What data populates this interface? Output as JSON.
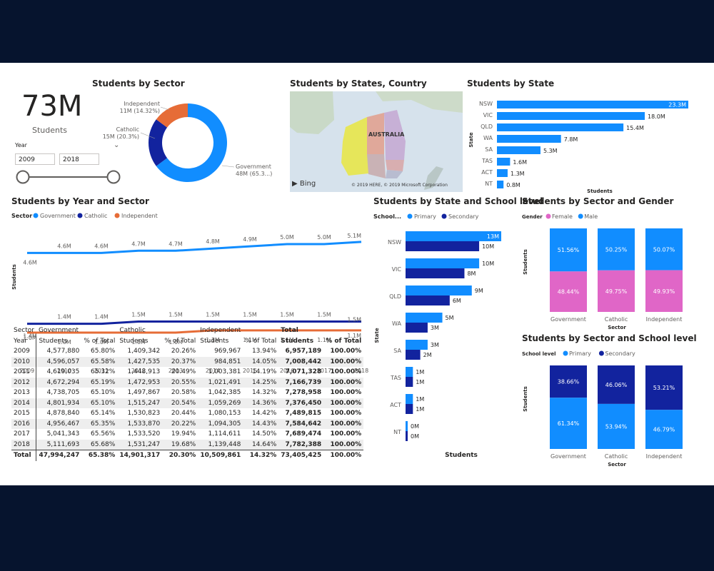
{
  "colors": {
    "government": "#118dff",
    "catholic": "#12239e",
    "independent": "#e66c37",
    "primary": "#118dff",
    "secondary": "#12239e",
    "female": "#e066c7",
    "male": "#118dff",
    "state_bar": "#118dff",
    "frame": "#06142e"
  },
  "card": {
    "value": "73M",
    "label": "Students"
  },
  "slicer": {
    "label": "Year",
    "from": "2009",
    "to": "2018",
    "chevron_icon": "chevron-down-icon"
  },
  "titles": {
    "sector": "Students by Sector",
    "map": "Students by States, Country",
    "state": "Students by State",
    "year_sector": "Students by Year and Sector",
    "state_level": "Students by State and School level",
    "sector_gender": "Students by Sector and Gender",
    "sector_level": "Students by Sector and School level"
  },
  "donut": {
    "slices": [
      {
        "name": "Government",
        "value": 48,
        "label_l1": "Government",
        "label_l2": "48M (65.3...)"
      },
      {
        "name": "Catholic",
        "value": 15,
        "label_l1": "Catholic",
        "label_l2": "15M (20.3%)"
      },
      {
        "name": "Independent",
        "value": 11,
        "label_l1": "Independent",
        "label_l2": "11M (14.32%)"
      }
    ]
  },
  "map": {
    "country_label": "AUSTRALIA",
    "bing": "Bing",
    "copyright": "© 2019 HERE, © 2019 Microsoft Corporation"
  },
  "state_chart": {
    "axis_y": "State",
    "axis_x": "Students",
    "categories": [
      "NSW",
      "VIC",
      "QLD",
      "WA",
      "SA",
      "TAS",
      "ACT",
      "NT"
    ],
    "values": [
      23.3,
      18.0,
      15.4,
      7.8,
      5.3,
      1.6,
      1.3,
      0.8
    ],
    "labels": [
      "23.3M",
      "18.0M",
      "15.4M",
      "7.8M",
      "5.3M",
      "1.6M",
      "1.3M",
      "0.8M"
    ]
  },
  "year_sector": {
    "legend_title": "Sector",
    "legend": [
      "Government",
      "Catholic",
      "Independent"
    ],
    "axis_y": "Students",
    "axis_x": "Year",
    "years": [
      "2009",
      "2010",
      "2011",
      "2012",
      "2013",
      "2014",
      "2015",
      "2016",
      "2017",
      "2018"
    ],
    "series": [
      {
        "name": "Government",
        "values": [
          4.6,
          4.6,
          4.6,
          4.7,
          4.7,
          4.8,
          4.9,
          5.0,
          5.0,
          5.1
        ],
        "labels": [
          "4.6M",
          "4.6M",
          "4.6M",
          "4.7M",
          "4.7M",
          "4.8M",
          "4.9M",
          "5.0M",
          "5.0M",
          "5.1M"
        ]
      },
      {
        "name": "Catholic",
        "values": [
          1.4,
          1.4,
          1.4,
          1.5,
          1.5,
          1.5,
          1.5,
          1.5,
          1.5,
          1.5
        ],
        "labels": [
          "1.4M",
          "1.4M",
          "1.4M",
          "1.5M",
          "1.5M",
          "1.5M",
          "1.5M",
          "1.5M",
          "1.5M",
          "1.5M"
        ]
      },
      {
        "name": "Independent",
        "values": [
          1.0,
          1.0,
          1.0,
          1.0,
          1.0,
          1.1,
          1.1,
          1.1,
          1.1,
          1.1
        ],
        "labels": [
          "1.0M",
          "1.0M",
          "1.0M",
          "1.0M",
          "1.0M",
          "1.1M",
          "1.1M",
          "1.1M",
          "1.1M",
          "1.1M"
        ]
      }
    ]
  },
  "matrix": {
    "header1": [
      "Sector",
      "Government",
      "",
      "Catholic",
      "",
      "Independent",
      "",
      "Total",
      ""
    ],
    "header2": [
      "Year",
      "Students",
      "% of Total",
      "Students",
      "% of Total",
      "Students",
      "% of Total",
      "Students",
      "% of Total"
    ],
    "rows": [
      [
        "2009",
        "4,577,880",
        "65.80%",
        "1,409,342",
        "20.26%",
        "969,967",
        "13.94%",
        "6,957,189",
        "100.00%"
      ],
      [
        "2010",
        "4,596,057",
        "65.58%",
        "1,427,535",
        "20.37%",
        "984,851",
        "14.05%",
        "7,008,442",
        "100.00%"
      ],
      [
        "2011",
        "4,619,035",
        "65.32%",
        "1,448,913",
        "20.49%",
        "1,003,381",
        "14.19%",
        "7,071,328",
        "100.00%"
      ],
      [
        "2012",
        "4,672,294",
        "65.19%",
        "1,472,953",
        "20.55%",
        "1,021,491",
        "14.25%",
        "7,166,739",
        "100.00%"
      ],
      [
        "2013",
        "4,738,705",
        "65.10%",
        "1,497,867",
        "20.58%",
        "1,042,385",
        "14.32%",
        "7,278,958",
        "100.00%"
      ],
      [
        "2014",
        "4,801,934",
        "65.10%",
        "1,515,247",
        "20.54%",
        "1,059,269",
        "14.36%",
        "7,376,450",
        "100.00%"
      ],
      [
        "2015",
        "4,878,840",
        "65.14%",
        "1,530,823",
        "20.44%",
        "1,080,153",
        "14.42%",
        "7,489,815",
        "100.00%"
      ],
      [
        "2016",
        "4,956,467",
        "65.35%",
        "1,533,870",
        "20.22%",
        "1,094,305",
        "14.43%",
        "7,584,642",
        "100.00%"
      ],
      [
        "2017",
        "5,041,343",
        "65.56%",
        "1,533,520",
        "19.94%",
        "1,114,611",
        "14.50%",
        "7,689,474",
        "100.00%"
      ],
      [
        "2018",
        "5,111,693",
        "65.68%",
        "1,531,247",
        "19.68%",
        "1,139,448",
        "14.64%",
        "7,782,388",
        "100.00%"
      ]
    ],
    "total": [
      "Total",
      "47,994,247",
      "65.38%",
      "14,901,317",
      "20.30%",
      "10,509,861",
      "14.32%",
      "73,405,425",
      "100.00%"
    ]
  },
  "state_level": {
    "legend_title": "School...",
    "legend": [
      "Primary",
      "Secondary"
    ],
    "axis_y": "State",
    "axis_x": "Students",
    "categories": [
      "NSW",
      "VIC",
      "QLD",
      "WA",
      "SA",
      "TAS",
      "ACT",
      "NT"
    ],
    "primary": [
      13,
      10,
      9,
      5,
      3,
      1,
      1,
      0
    ],
    "secondary": [
      10,
      8,
      6,
      3,
      2,
      1,
      1,
      0
    ],
    "primary_labels": [
      "13M",
      "10M",
      "9M",
      "5M",
      "3M",
      "1M",
      "1M",
      "0M"
    ],
    "secondary_labels": [
      "10M",
      "8M",
      "6M",
      "3M",
      "2M",
      "1M",
      "1M",
      "0M"
    ]
  },
  "gender": {
    "legend_title": "Gender",
    "legend": [
      "Female",
      "Male"
    ],
    "axis_y": "Students",
    "axis_x": "Sector",
    "categories": [
      "Government",
      "Catholic",
      "Independent"
    ],
    "male": [
      51.56,
      50.25,
      50.07
    ],
    "female": [
      48.44,
      49.75,
      49.93
    ],
    "male_labels": [
      "51.56%",
      "50.25%",
      "50.07%"
    ],
    "female_labels": [
      "48.44%",
      "49.75%",
      "49.93%"
    ]
  },
  "level": {
    "legend_title": "School level",
    "legend": [
      "Primary",
      "Secondary"
    ],
    "axis_y": "Students",
    "axis_x": "Sector",
    "categories": [
      "Government",
      "Catholic",
      "Independent"
    ],
    "primary": [
      61.34,
      53.94,
      46.79
    ],
    "secondary": [
      38.66,
      46.06,
      53.21
    ],
    "primary_labels": [
      "61.34%",
      "53.94%",
      "46.79%"
    ],
    "secondary_labels": [
      "38.66%",
      "46.06%",
      "53.21%"
    ]
  },
  "chart_data": [
    {
      "type": "pie",
      "title": "Students by Sector",
      "categories": [
        "Government",
        "Catholic",
        "Independent"
      ],
      "values": [
        48,
        15,
        11
      ]
    },
    {
      "type": "bar",
      "title": "Students by State",
      "categories": [
        "NSW",
        "VIC",
        "QLD",
        "WA",
        "SA",
        "TAS",
        "ACT",
        "NT"
      ],
      "values": [
        23.3,
        18.0,
        15.4,
        7.8,
        5.3,
        1.6,
        1.3,
        0.8
      ],
      "xlabel": "Students",
      "ylabel": "State"
    },
    {
      "type": "line",
      "title": "Students by Year and Sector",
      "x": [
        2009,
        2010,
        2011,
        2012,
        2013,
        2014,
        2015,
        2016,
        2017,
        2018
      ],
      "series": [
        {
          "name": "Government",
          "values": [
            4.6,
            4.6,
            4.6,
            4.7,
            4.7,
            4.8,
            4.9,
            5.0,
            5.0,
            5.1
          ]
        },
        {
          "name": "Catholic",
          "values": [
            1.4,
            1.4,
            1.4,
            1.5,
            1.5,
            1.5,
            1.5,
            1.5,
            1.5,
            1.5
          ]
        },
        {
          "name": "Independent",
          "values": [
            1.0,
            1.0,
            1.0,
            1.0,
            1.0,
            1.1,
            1.1,
            1.1,
            1.1,
            1.1
          ]
        }
      ],
      "xlabel": "Year",
      "ylabel": "Students"
    },
    {
      "type": "bar",
      "title": "Students by State and School level",
      "categories": [
        "NSW",
        "VIC",
        "QLD",
        "WA",
        "SA",
        "TAS",
        "ACT",
        "NT"
      ],
      "series": [
        {
          "name": "Primary",
          "values": [
            13,
            10,
            9,
            5,
            3,
            1,
            1,
            0
          ]
        },
        {
          "name": "Secondary",
          "values": [
            10,
            8,
            6,
            3,
            2,
            1,
            1,
            0
          ]
        }
      ],
      "xlabel": "Students",
      "ylabel": "State"
    },
    {
      "type": "bar",
      "title": "Students by Sector and Gender",
      "categories": [
        "Government",
        "Catholic",
        "Independent"
      ],
      "series": [
        {
          "name": "Female",
          "values": [
            48.44,
            49.75,
            49.93
          ]
        },
        {
          "name": "Male",
          "values": [
            51.56,
            50.25,
            50.07
          ]
        }
      ],
      "xlabel": "Sector",
      "ylabel": "Students"
    },
    {
      "type": "bar",
      "title": "Students by Sector and School level",
      "categories": [
        "Government",
        "Catholic",
        "Independent"
      ],
      "series": [
        {
          "name": "Primary",
          "values": [
            61.34,
            53.94,
            46.79
          ]
        },
        {
          "name": "Secondary",
          "values": [
            38.66,
            46.06,
            53.21
          ]
        }
      ],
      "xlabel": "Sector",
      "ylabel": "Students"
    }
  ]
}
